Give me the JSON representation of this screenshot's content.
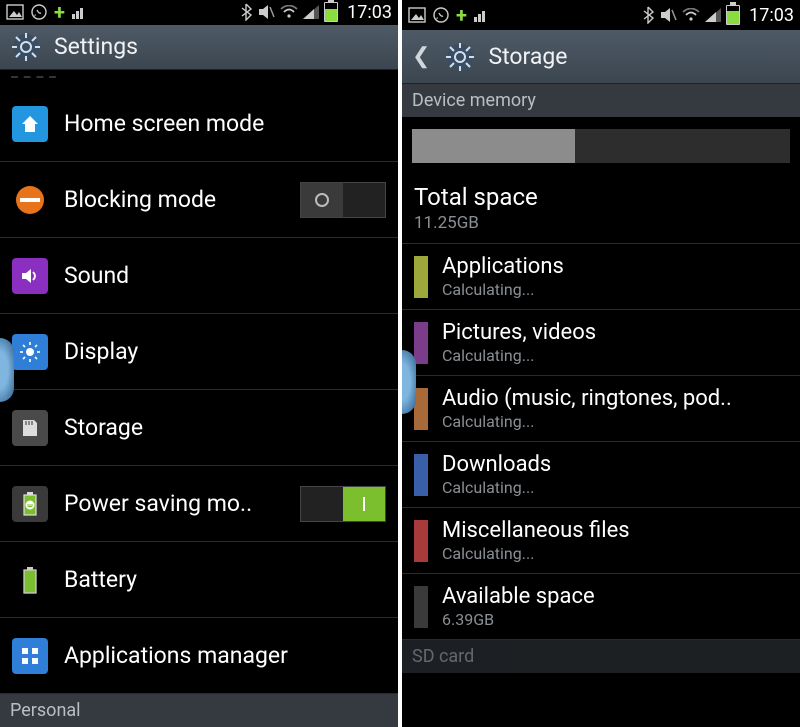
{
  "status": {
    "time": "17:03"
  },
  "left": {
    "title": "Settings",
    "items": [
      {
        "label": "Home screen mode"
      },
      {
        "label": "Blocking mode"
      },
      {
        "label": "Sound"
      },
      {
        "label": "Display"
      },
      {
        "label": "Storage"
      },
      {
        "label": "Power saving mo.."
      },
      {
        "label": "Battery"
      },
      {
        "label": "Applications manager"
      }
    ],
    "personal_header": "Personal"
  },
  "right": {
    "title": "Storage",
    "device_memory_header": "Device memory",
    "used_percent": 43,
    "total_label": "Total space",
    "total_value": "11.25GB",
    "categories": [
      {
        "label": "Applications",
        "sub": "Calculating...",
        "color": "#9ea83a"
      },
      {
        "label": "Pictures, videos",
        "sub": "Calculating...",
        "color": "#7b3d8a"
      },
      {
        "label": "Audio (music, ringtones, pod..",
        "sub": "Calculating...",
        "color": "#a96a3a"
      },
      {
        "label": "Downloads",
        "sub": "Calculating...",
        "color": "#3a5fa9"
      },
      {
        "label": "Miscellaneous files",
        "sub": "Calculating...",
        "color": "#a93a3a"
      },
      {
        "label": "Available space",
        "sub": "6.39GB",
        "color": "#3a3a3a"
      }
    ],
    "sd_header": "SD card"
  }
}
